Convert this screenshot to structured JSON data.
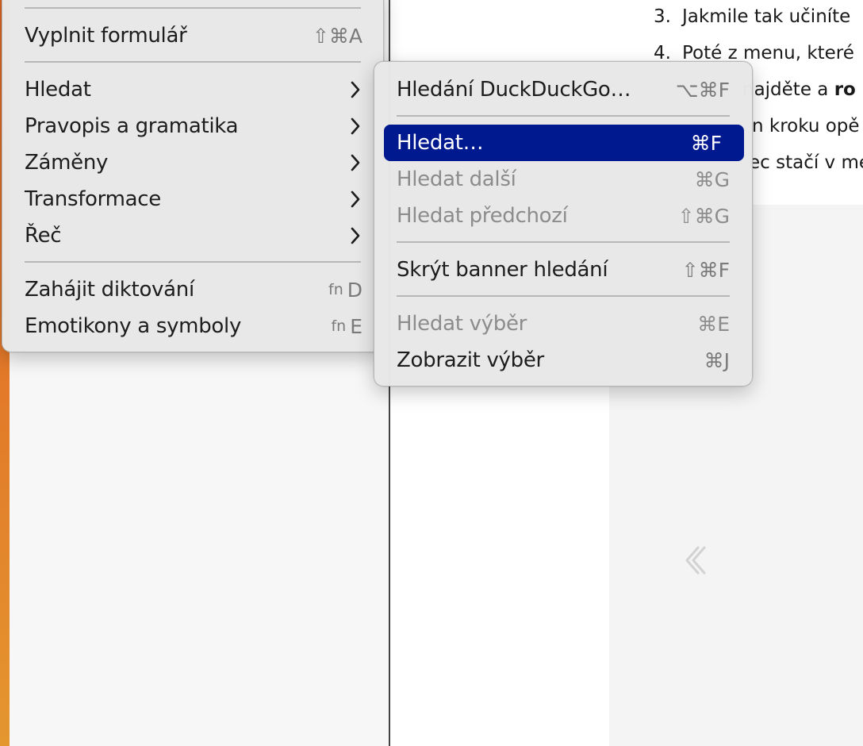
{
  "document": {
    "lines": [
      {
        "num": "3.",
        "text": "Jakmile tak učiníte"
      },
      {
        "num": "4.",
        "text": "Poté z menu, které"
      },
      {
        "pre": "najděte a ",
        "bold": "ro"
      },
      {
        "text": "n kroku opě"
      },
      {
        "text": "ec stačí v me"
      }
    ]
  },
  "main_menu": {
    "items": [
      {
        "label": "Vyplnit formulář",
        "shortcut": "⇧⌘A"
      },
      {
        "label": "Hledat",
        "submenu": true
      },
      {
        "label": "Pravopis a gramatika",
        "submenu": true
      },
      {
        "label": "Záměny",
        "submenu": true
      },
      {
        "label": "Transformace",
        "submenu": true
      },
      {
        "label": "Řeč",
        "submenu": true
      },
      {
        "label": "Zahájit diktování",
        "shortcut_fn": "fn",
        "shortcut": "D"
      },
      {
        "label": "Emotikony a symboly",
        "shortcut_fn": "fn",
        "shortcut": "E"
      }
    ]
  },
  "sub_menu": {
    "items": [
      {
        "label": "Hledání DuckDuckGo…",
        "shortcut": "⌥⌘F",
        "enabled": true
      },
      {
        "label": "Hledat…",
        "shortcut": "⌘F",
        "enabled": true,
        "selected": true
      },
      {
        "label": "Hledat další",
        "shortcut": "⌘G",
        "enabled": false
      },
      {
        "label": "Hledat předchozí",
        "shortcut": "⇧⌘G",
        "enabled": false
      },
      {
        "label": "Skrýt banner hledání",
        "shortcut": "⇧⌘F",
        "enabled": true
      },
      {
        "label": "Hledat výběr",
        "shortcut": "⌘E",
        "enabled": false
      },
      {
        "label": "Zobrazit výběr",
        "shortcut": "⌘J",
        "enabled": true
      }
    ]
  },
  "icons": {
    "submenu_arrow": "chevron-right-icon",
    "back": "chevron-left-icon"
  },
  "colors": {
    "selection": "#00198f",
    "menu_bg": "#e8e8e8",
    "disabled_text": "#8c8c8c"
  }
}
